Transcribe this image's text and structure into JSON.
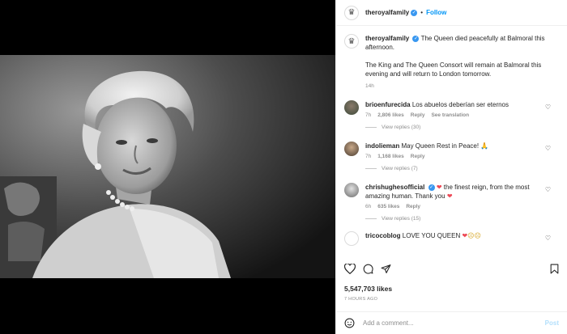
{
  "media": {
    "image_alt": "The Queen"
  },
  "header": {
    "username": "theroyalfamily",
    "verified_symbol": "✓",
    "separator": "•",
    "follow_label": "Follow"
  },
  "caption": {
    "username": "theroyalfamily",
    "text1": "The Queen died peacefully at Balmoral this afternoon.",
    "text2": "The King and The Queen Consort will remain at Balmoral this evening and will return to London tomorrow.",
    "time": "14h"
  },
  "comments": [
    {
      "username": "brioenfurecida",
      "text": "Los abuelos deberían ser eternos",
      "time": "7h",
      "likes": "2,806 likes",
      "reply": "Reply",
      "extra": "See translation",
      "view_replies": "View replies (30)"
    },
    {
      "username": "indolieman",
      "text": "May Queen Rest in Peace! 🙏",
      "time": "7h",
      "likes": "1,168 likes",
      "reply": "Reply",
      "view_replies": "View replies (7)"
    },
    {
      "username": "chrishughesofficial",
      "text": "the finest reign, from the most amazing human. Thank you",
      "time": "6h",
      "likes": "635 likes",
      "reply": "Reply",
      "view_replies": "View replies (15)"
    },
    {
      "username": "tricocoblog",
      "text": "LOVE YOU QUEEN"
    }
  ],
  "likes": "5,547,703 likes",
  "time_ago": "7 HOURS AGO",
  "add_comment": {
    "placeholder": "Add a comment...",
    "post_label": "Post"
  },
  "colors": {
    "link_blue": "#0095f6",
    "verified_blue": "#3897f0",
    "heart_red": "#ed4956",
    "post_disabled": "#b2dffc"
  },
  "icons": [
    "heart-icon",
    "comment-icon",
    "share-icon",
    "bookmark-icon",
    "emoji-icon",
    "verified-icon",
    "royal-crest-icon"
  ]
}
